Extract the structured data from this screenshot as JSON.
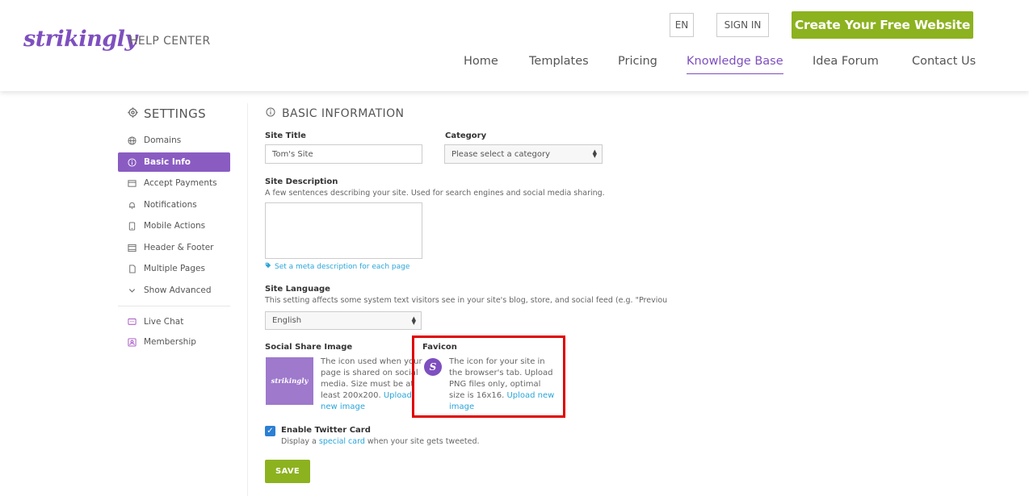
{
  "header": {
    "logo": "strikingly",
    "help_center": "HELP CENTER",
    "lang": "EN",
    "sign_in": "SIGN IN",
    "create": "Create Your Free Website",
    "nav": [
      "Home",
      "Templates",
      "Pricing",
      "Knowledge Base",
      "Idea Forum",
      "Contact Us"
    ],
    "active_nav": "Knowledge Base"
  },
  "sidebar": {
    "title": "SETTINGS",
    "items": [
      {
        "label": "Domains",
        "icon": "globe-icon"
      },
      {
        "label": "Basic Info",
        "icon": "info-icon"
      },
      {
        "label": "Accept Payments",
        "icon": "card-icon"
      },
      {
        "label": "Notifications",
        "icon": "bell-icon"
      },
      {
        "label": "Mobile Actions",
        "icon": "mobile-icon"
      },
      {
        "label": "Header & Footer",
        "icon": "layout-icon"
      },
      {
        "label": "Multiple Pages",
        "icon": "pages-icon"
      },
      {
        "label": "Show Advanced",
        "icon": "chevron-down-icon"
      }
    ],
    "extra": [
      {
        "label": "Live Chat",
        "icon": "chat-icon"
      },
      {
        "label": "Membership",
        "icon": "member-icon"
      }
    ],
    "active": "Basic Info"
  },
  "main": {
    "title": "BASIC INFORMATION",
    "site_title_label": "Site Title",
    "site_title_value": "Tom's Site",
    "category_label": "Category",
    "category_value": "Please select a category",
    "desc_label": "Site Description",
    "desc_help": "A few sentences describing your site. Used for search engines and social media sharing.",
    "meta_link": "Set a meta description for each page",
    "lang_label": "Site Language",
    "lang_help": "This setting affects some system text visitors see in your site's blog, store, and social feed (e.g. \"Previou",
    "lang_value": "English",
    "share_label": "Social Share Image",
    "share_text": "The icon used when your page is shared on social media. Size must be at least 200x200.",
    "share_link": "Upload new image",
    "share_img_text": "strikingly",
    "favicon_label": "Favicon",
    "favicon_letter": "S",
    "favicon_text": "The icon for your site in the browser's tab. Upload PNG files only, optimal size is 16x16.",
    "favicon_link": "Upload new image",
    "twitter_label": "Enable Twitter Card",
    "twitter_help_pre": "Display a",
    "twitter_help_link": "special card",
    "twitter_help_post": "when your site gets tweeted.",
    "save": "SAVE"
  },
  "colors": {
    "accent": "#7e4fbf",
    "green": "#8cb21f",
    "link": "#2ba5d8",
    "highlight": "#e00000"
  }
}
